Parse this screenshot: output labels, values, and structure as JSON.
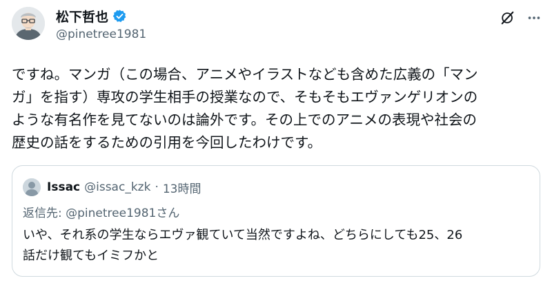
{
  "author": {
    "display_name": "松下哲也",
    "handle": "@pinetree1981",
    "verified_icon": "verified-badge-icon",
    "avatar_icon": "avatar-illustration"
  },
  "actions": {
    "grok_icon": "grok-icon",
    "more_icon": "more-options-icon"
  },
  "tweet": {
    "lines": [
      "ですね。マンガ（この場合、アニメやイラストなども含めた広義の「マン",
      "ガ」を指す）専攻の学生相手の授業なので、そもそもエヴァンゲリオンの",
      "ような有名作を見てないのは論外です。その上でのアニメの表現や社会の",
      "歴史の話をするための引用を今回したわけです。"
    ]
  },
  "quote": {
    "display_name": "Issac",
    "handle": "@issac_kzk",
    "separator": "·",
    "time": "13時間",
    "reply_prefix": "返信先: ",
    "reply_to": "@pinetree1981さん",
    "lines": [
      "いや、それ系の学生ならエヴァ観ていて当然ですよね、どちらにしても25、26",
      "話だけ観てもイミフかと"
    ]
  },
  "colors": {
    "text": "#0f1419",
    "secondary": "#536471",
    "verified": "#1d9bf0",
    "border": "#cfd9de"
  }
}
